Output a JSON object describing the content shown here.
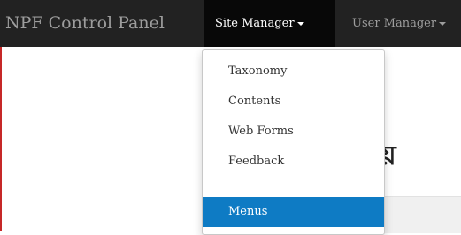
{
  "navbar": {
    "brand": "NPF Control Panel",
    "items": [
      {
        "label": "Site Manager",
        "active": true
      },
      {
        "label": "User Manager",
        "active": false
      }
    ]
  },
  "dropdown": {
    "items": [
      {
        "label": "Taxonomy"
      },
      {
        "label": "Contents"
      },
      {
        "label": "Web Forms"
      },
      {
        "label": "Feedback"
      }
    ],
    "highlighted_item": "Menus"
  },
  "page": {
    "partial_heading": "য়"
  },
  "colors": {
    "navbar_bg": "#222222",
    "active_bg": "#080808",
    "highlight": "#0e7bc4",
    "frame_border": "#c62828"
  }
}
